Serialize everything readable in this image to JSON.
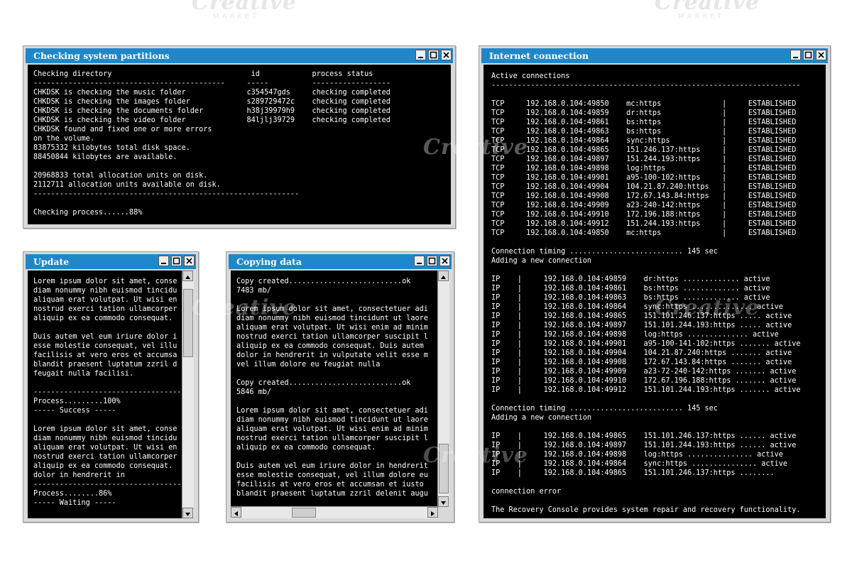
{
  "watermark": {
    "text": "Creative",
    "sub": "MARKET"
  },
  "windows": {
    "partitions": {
      "title": "Checking system partitions",
      "lines": [
        "Checking directory                                id            process status",
        "--------------------------------------------     -----          ------------------",
        "CHKDSK is checking the music folder              c354547gds     checking completed",
        "CHKDSK is checking the images folder             s289729472c    checking completed",
        "CHKDSK is checking the documents folder          h38j39979h9    checking completed",
        "CHKDSK is checking the video folder              84ljlj39729    checking completed",
        "CHKDSK found and fixed one or more errors",
        "on the volume.",
        "83875332 kilobytes total disk space.",
        "88450844 kilobytes are available.",
        "",
        "20968833 total allocation units on disk.",
        "2112711 allocation units available on disk.",
        "-------------------------------------------------------------",
        "",
        "Checking process......88%"
      ]
    },
    "update": {
      "title": "Update",
      "lines": [
        "Lorem ipsum dolor sit amet, conse",
        "diam nonummy nibh euismod tincidu",
        "aliquam erat volutpat. Ut wisi en",
        "nostrud exerci tation ullamcorper",
        "aliquip ex ea commodo consequat.",
        "",
        "Duis autem vel eum iriure dolor i",
        "esse molestie consequat, vel illu",
        "facilisis at vero eros et accumsa",
        "blandit praesent luptatum zzril d",
        "feugait nulla facilisi.",
        "",
        "----------------------------------",
        "Process.........100%",
        "----- Success -----",
        "",
        "Lorem ipsum dolor sit amet, conse",
        "diam nonummy nibh euismod tincidu",
        "aliquam erat volutpat. Ut wisi en",
        "nostrud exerci tation ullamcorper",
        "aliquip ex ea commodo consequat.",
        "dolor in hendrerit in",
        "----------------------------------",
        "Process........86%",
        "----- Waiting -----"
      ]
    },
    "copying": {
      "title": "Copying data",
      "lines": [
        "Copy created..........................ok",
        "7483 mb/",
        "",
        "Lorem ipsum dolor sit amet, consectetuer adi",
        "diam nonummy nibh euismod tincidunt ut laore",
        "aliquam erat volutpat. Ut wisi enim ad minim",
        "nostrud exerci tation ullamcorper suscipit l",
        "aliquip ex ea commodo consequat. Duis autem",
        "dolor in hendrerit in vulputate velit esse m",
        "vel illum dolore eu feugiat nulla",
        "",
        "Copy created..........................ok",
        "5846 mb/",
        "",
        "Lorem ipsum dolor sit amet, consectetuer adi",
        "diam nonummy nibh euismod tincidunt ut laore",
        "aliquam erat volutpat. Ut wisi enim ad minim",
        "nostrud exerci tation ullamcorper suscipit l",
        "aliquip ex ea commodo consequat.",
        "",
        "Duis autem vel eum iriure dolor in hendrerit",
        "esse molestie consequat, vel illum dolore eu",
        "facilisis at vero eros et accumsan et iusto",
        "blandit praesent luptatum zzril delenit augu"
      ]
    },
    "internet": {
      "title": "Internet connection",
      "lines": [
        "Active connections",
        "-----------------------------------------------------------------------",
        "",
        "TCP     192.168.0.104:49850    mc:https              |     ESTABLISHED",
        "TCP     192.168.0.104:49859    dr:https              |     ESTABLISHED",
        "TCP     192.168.0.104:49861    bs:https              |     ESTABLISHED",
        "TCP     192.168.0.104:49863    bs:https              |     ESTABLISHED",
        "TCP     192.168.0.104:49864    sync:https            |     ESTABLISHED",
        "TCP     192.168.0.104:49865    151.246.137:https     |     ESTABLISHED",
        "TCP     192.168.0.104:49897    151.244.193:https     |     ESTABLISHED",
        "TCP     192.168.0.104:49898    log:https             |     ESTABLISHED",
        "TCP     192.168.0.104:49901    a95-100-102:https     |     ESTABLISHED",
        "TCP     192.168.0.104:49904    104.21.87.240:https   |     ESTABLISHED",
        "TCP     192.168.0.104:49908    172.67.143.84:https   |     ESTABLISHED",
        "TCP     192.168.0.104:49909    a23-240-142:https     |     ESTABLISHED",
        "TCP     192.168.0.104:49910    172.196.188:https     |     ESTABLISHED",
        "TCP     192.168.0.104:49912    151.244.193:https     |     ESTABLISHED",
        "TCP     192.168.0.104:49850    mc:https              |     ESTABLISHED",
        "",
        "Connection timing .......................... 145 sec",
        "Adding a new connection",
        "",
        "IP    |     192.168.0.104:49859    dr:https ............. active",
        "IP    |     192.168.0.104:49861    bs:https ............. active",
        "IP    |     192.168.0.104:49863    bs:https ............. active",
        "IP    |     192.168.0.104:49864    sync:https .............. active",
        "IP    |     192.168.0.104:49865    151.101.246.137:https ..... active",
        "IP    |     192.168.0.104:49897    151.101.244.193:https ..... active",
        "IP    |     192.168.0.104:49898    log:https .............. active",
        "IP    |     192.168.0.104:49901    a95-100-141-102:https ....... active",
        "IP    |     192.168.0.104:49904    104.21.87.240:https ....... active",
        "IP    |     192.168.0.104:49908    172.67.143.84:https ....... active",
        "IP    |     192.168.0.104:49909    a23-72-240-142:https ....... active",
        "IP    |     192.168.0.104:49910    172.67.196.188:https ....... active",
        "IP    |     192.168.0.104:49912    151.101.244.193:https ....... active",
        "",
        "Connection timing .......................... 145 sec",
        "Adding a new connection",
        "",
        "IP    |     192.168.0.104:49865    151.101.246.137:https ...... active",
        "IP    |     192.168.0.104:49897    151.101.244.193:https ...... active",
        "IP    |     192.168.0.104:49898    log:https ............... active",
        "IP    |     192.168.0.104:49864    sync:https ............... active",
        "IP    |     192.168.0.104:49865    151.101.246.137:https ........",
        "",
        "connection error",
        "",
        "The Recovery Console provides system repair and recovery functionality."
      ]
    }
  },
  "icons": {
    "minimize": "minimize-icon",
    "maximize": "maximize-icon",
    "close": "close-icon"
  }
}
